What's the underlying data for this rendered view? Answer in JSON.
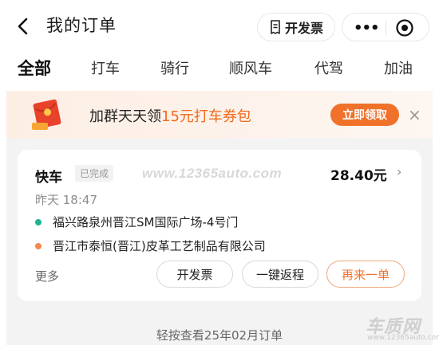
{
  "header": {
    "title": "我的订单",
    "invoice_label": "开发票"
  },
  "tabs": [
    {
      "label": "全部",
      "active": true
    },
    {
      "label": "打车"
    },
    {
      "label": "骑行"
    },
    {
      "label": "顺风车"
    },
    {
      "label": "代驾"
    },
    {
      "label": "加油"
    }
  ],
  "banner": {
    "text_pre": "加群天天领",
    "text_highlight": "15元打车券包",
    "button": "立即领取",
    "close": "×"
  },
  "order": {
    "service": "快车",
    "status": "已完成",
    "price": "28.40元",
    "time": "昨天 18:47",
    "from": "福兴路泉州晋江SM国际广场-4号门",
    "to": "晋江市泰恒(晋江)皮革工艺制品有限公司",
    "more": "更多",
    "actions": [
      "开发票",
      "一键返程",
      "再来一单"
    ]
  },
  "watermark": "www.12365auto.com",
  "footer_hint": "轻按查看25年02月订单",
  "logo": {
    "big": "车质网",
    "small": "www.12365auto.com"
  },
  "colors": {
    "accent": "#f0722a",
    "start_dot": "#1cb394",
    "end_dot": "#f28a4d"
  }
}
